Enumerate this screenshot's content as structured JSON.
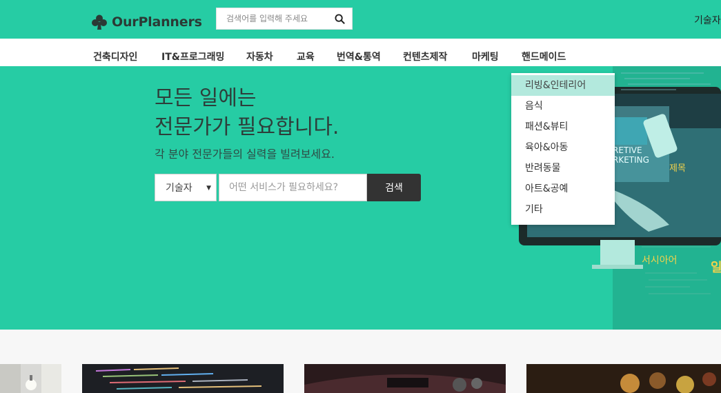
{
  "header": {
    "logo_text": "OurPlanners",
    "logo_icon": "club-icon",
    "search_placeholder": "검색어를 입력해 주세요",
    "right_link": "기술자"
  },
  "nav": {
    "items": [
      "건축디자인",
      "IT&프로그래밍",
      "자동차",
      "교육",
      "번역&통역",
      "컨텐츠제작",
      "마케팅",
      "핸드메이드"
    ]
  },
  "hero": {
    "title_line1": "모든 일에는",
    "title_line2": "전문가가 필요합니다.",
    "subtitle": "각 분야 전문가들의 실력을 빌려보세요.",
    "select_value": "기술자",
    "input_placeholder": "어떤 서비스가 필요하세요?",
    "search_button": "검색",
    "art_text_1": "RETIVE",
    "art_text_2": "RKETING",
    "art_text_3": "제목",
    "art_text_4": "서시아어",
    "art_text_5": "일"
  },
  "dropdown": {
    "items": [
      "리빙&인테리어",
      "음식",
      "패션&뷰티",
      "육아&아동",
      "반려동물",
      "아트&공예",
      "기타"
    ],
    "active_index": 0
  },
  "colors": {
    "brand_green": "#26cca4",
    "dark_button": "#333333",
    "dropdown_active": "#b3e9dd"
  }
}
